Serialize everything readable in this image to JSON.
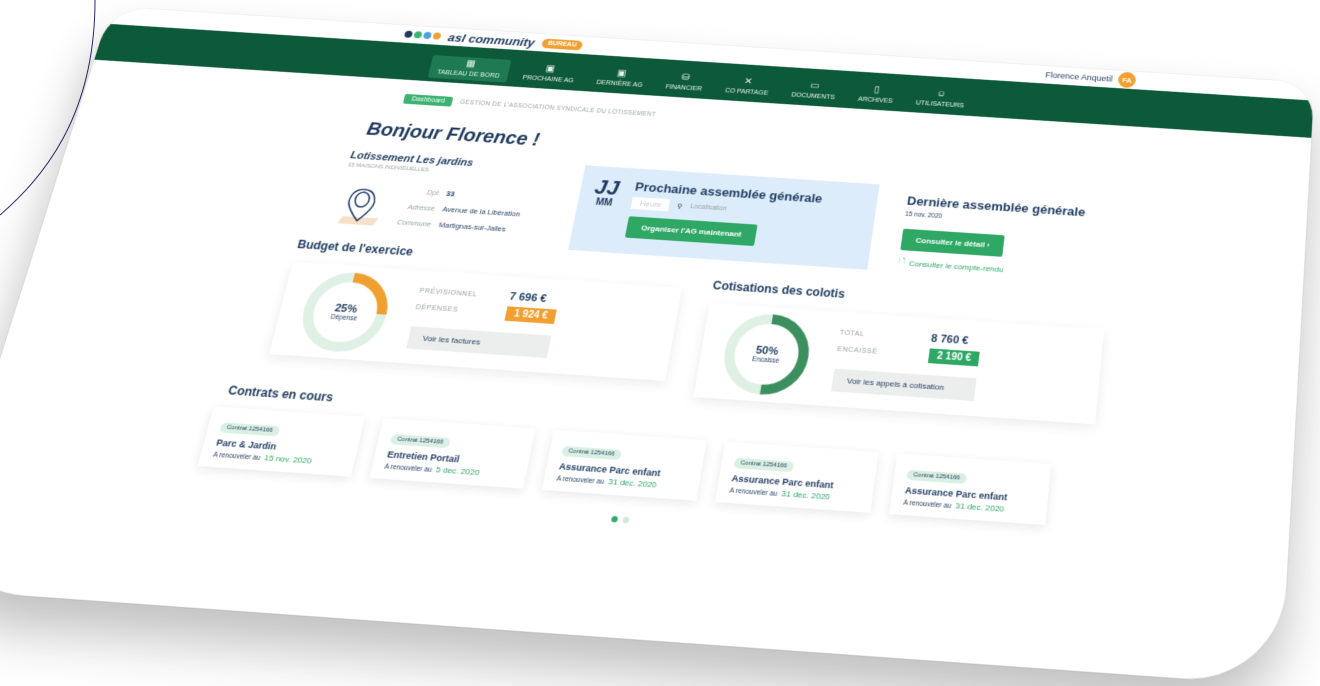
{
  "brand": {
    "name": "asl community",
    "badge": "BUREAU",
    "colors": {
      "dot1": "#1e3a5f",
      "dot2": "#3cb371",
      "dot3": "#4aa3df",
      "dot4": "#f0a030"
    }
  },
  "user": {
    "name": "Florence Anquetil",
    "initials": "FA"
  },
  "nav": [
    {
      "label": "TABLEAU DE BORD",
      "icon": "dashboard-icon",
      "glyph": "▦"
    },
    {
      "label": "PROCHAINE AG",
      "icon": "calendar-icon",
      "glyph": "▣"
    },
    {
      "label": "DERNIÈRE AG",
      "icon": "calendar-icon",
      "glyph": "▣"
    },
    {
      "label": "FINANCIER",
      "icon": "money-icon",
      "glyph": "⛁"
    },
    {
      "label": "CO PARTAGE",
      "icon": "tools-icon",
      "glyph": "✕"
    },
    {
      "label": "DOCUMENTS",
      "icon": "folder-icon",
      "glyph": "▭"
    },
    {
      "label": "ARCHIVES",
      "icon": "archive-icon",
      "glyph": "▯"
    },
    {
      "label": "UTILISATEURS",
      "icon": "users-icon",
      "glyph": "☺"
    }
  ],
  "breadcrumb": {
    "pill": "Dashboard",
    "text": "GESTION DE L'ASSOCIATION SYNDICALE DU LOTISSEMENT"
  },
  "greeting": "Bonjour Florence !",
  "lotissement": {
    "title": "Lotissement Les jardins",
    "subtitle": "15 MAISONS INDIVIDUELLES",
    "rows": [
      {
        "k": "Dpt",
        "v": "33"
      },
      {
        "k": "Adresse",
        "v": "Avenue de la Libération"
      },
      {
        "k": "Commune",
        "v": "Martignas-sur-Jalles"
      }
    ]
  },
  "next_ag": {
    "day": "JJ",
    "month": "MM",
    "title": "Prochaine assemblée générale",
    "heure_placeholder": "Heure",
    "localisation": "Localisation",
    "button": "Organiser l'AG maintenant"
  },
  "last_ag": {
    "title": "Dernière assemblée générale",
    "date": "15 nov. 2020",
    "button": "Consulter le détail",
    "link": "Consulter le compte-rendu"
  },
  "budget": {
    "title": "Budget de l'exercice",
    "percent_text": "25%",
    "percent_value": 25,
    "caption": "Dépensé",
    "prev_label": "PRÉVISIONNEL",
    "prev_value": "7 696 €",
    "dep_label": "DÉPENSES",
    "dep_value": "1 924 €",
    "button": "Voir les factures",
    "color": "#f0a030",
    "track_color": "#dff0e5"
  },
  "cotisations": {
    "title": "Cotisations des colotis",
    "percent_text": "50%",
    "percent_value": 50,
    "caption": "Encaissé",
    "total_label": "TOTAL",
    "total_value": "8 760 €",
    "enc_label": "ENCAISSÉ",
    "enc_value": "2 190 €",
    "button": "Voir les appels à cotisation",
    "color": "#3c8f5e",
    "track_color": "#dff0e5"
  },
  "contracts": {
    "title": "Contrats en cours",
    "renew_label": "A renouveler au",
    "items": [
      {
        "id": "Contrat 1254166",
        "name": "Parc & Jardin",
        "date": "15 nov. 2020"
      },
      {
        "id": "Contrat 1254166",
        "name": "Entretien Portail",
        "date": "5 dec. 2020"
      },
      {
        "id": "Contrat 1254166",
        "name": "Assurance Parc enfant",
        "date": "31 dec. 2020"
      },
      {
        "id": "Contrat 1254166",
        "name": "Assurance Parc enfant",
        "date": "31 dec. 2020"
      },
      {
        "id": "Contrat 1254166",
        "name": "Assurance Parc enfant",
        "date": "31 dec. 2020"
      }
    ]
  }
}
